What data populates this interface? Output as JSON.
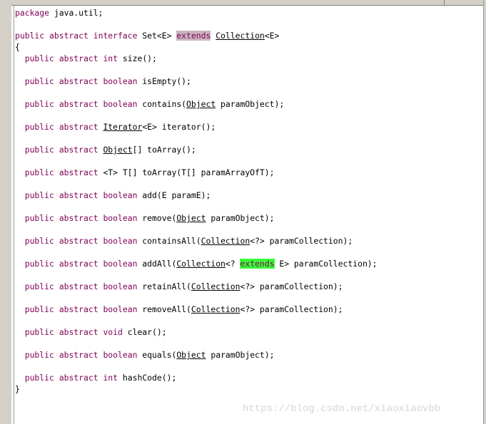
{
  "code_lines": [
    [
      {
        "t": "package",
        "kw": 1
      },
      {
        "t": " java.util;"
      }
    ],
    [
      {
        "t": "public abstract interface",
        "kw": 1
      },
      {
        "t": " Set<E> "
      },
      {
        "t": "extends",
        "kw": 1,
        "hl": "gray"
      },
      {
        "t": " "
      },
      {
        "t": "Collection",
        "ref": 1
      },
      {
        "t": "<E>"
      }
    ],
    [
      {
        "t": "{"
      }
    ],
    [
      {
        "t": "  "
      },
      {
        "t": "public abstract int",
        "kw": 1
      },
      {
        "t": " size();"
      }
    ],
    [
      {
        "t": "  "
      },
      {
        "t": "public abstract boolean",
        "kw": 1
      },
      {
        "t": " isEmpty();"
      }
    ],
    [
      {
        "t": "  "
      },
      {
        "t": "public abstract boolean",
        "kw": 1
      },
      {
        "t": " contains("
      },
      {
        "t": "Object",
        "ref": 1
      },
      {
        "t": " paramObject);"
      }
    ],
    [
      {
        "t": "  "
      },
      {
        "t": "public abstract",
        "kw": 1
      },
      {
        "t": " "
      },
      {
        "t": "Iterator",
        "ref": 1
      },
      {
        "t": "<E> iterator();"
      }
    ],
    [
      {
        "t": "  "
      },
      {
        "t": "public abstract",
        "kw": 1
      },
      {
        "t": " "
      },
      {
        "t": "Object",
        "ref": 1
      },
      {
        "t": "[] toArray();"
      }
    ],
    [
      {
        "t": "  "
      },
      {
        "t": "public abstract",
        "kw": 1
      },
      {
        "t": " <T> T[] toArray(T[] paramArrayOfT);"
      }
    ],
    [
      {
        "t": "  "
      },
      {
        "t": "public abstract boolean",
        "kw": 1
      },
      {
        "t": " add(E paramE);"
      }
    ],
    [
      {
        "t": "  "
      },
      {
        "t": "public abstract boolean",
        "kw": 1
      },
      {
        "t": " remove("
      },
      {
        "t": "Object",
        "ref": 1
      },
      {
        "t": " paramObject);"
      }
    ],
    [
      {
        "t": "  "
      },
      {
        "t": "public abstract boolean",
        "kw": 1
      },
      {
        "t": " containsAll("
      },
      {
        "t": "Collection",
        "ref": 1
      },
      {
        "t": "<?> paramCollection);"
      }
    ],
    [
      {
        "t": "  "
      },
      {
        "t": "public abstract boolean",
        "kw": 1
      },
      {
        "t": " addAll("
      },
      {
        "t": "Collection",
        "ref": 1
      },
      {
        "t": "<? "
      },
      {
        "t": "extends",
        "kw": 1,
        "hl": "green"
      },
      {
        "t": " E> paramCollection);"
      }
    ],
    [
      {
        "t": "  "
      },
      {
        "t": "public abstract boolean",
        "kw": 1
      },
      {
        "t": " retainAll("
      },
      {
        "t": "Collection",
        "ref": 1
      },
      {
        "t": "<?> paramCollection);"
      }
    ],
    [
      {
        "t": "  "
      },
      {
        "t": "public abstract boolean",
        "kw": 1
      },
      {
        "t": " removeAll("
      },
      {
        "t": "Collection",
        "ref": 1
      },
      {
        "t": "<?> paramCollection);"
      }
    ],
    [
      {
        "t": "  "
      },
      {
        "t": "public abstract void",
        "kw": 1
      },
      {
        "t": " clear();"
      }
    ],
    [
      {
        "t": "  "
      },
      {
        "t": "public abstract boolean",
        "kw": 1
      },
      {
        "t": " equals("
      },
      {
        "t": "Object",
        "ref": 1
      },
      {
        "t": " paramObject);"
      }
    ],
    [
      {
        "t": "  "
      },
      {
        "t": "public abstract int",
        "kw": 1
      },
      {
        "t": " hashCode();"
      }
    ],
    [
      {
        "t": "}"
      }
    ]
  ],
  "colors": {
    "keyword": "#7f0055",
    "highlight_selected": "#c9b4c0",
    "highlight_match": "#38ff38"
  },
  "watermark": "https://blog.csdn.net/xiaoxiaovbb"
}
